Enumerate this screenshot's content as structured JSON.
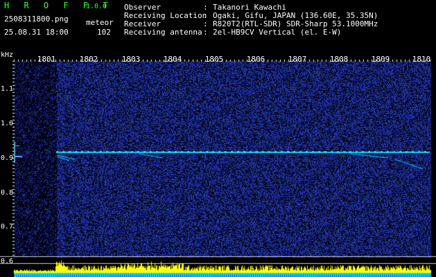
{
  "header": {
    "app_name": "H R O F F T",
    "version": "1.0.0",
    "filename": "2508311800.png",
    "category": "meteor",
    "datetime": "25.08.31 18:00",
    "count": "102"
  },
  "info": [
    {
      "label": "Observer",
      "value": "Takanori Kawachi"
    },
    {
      "label": "Receiving Location",
      "value": "Ogaki, Gifu, JAPAN (136.60E, 35.35N)"
    },
    {
      "label": "Receiver",
      "value": "R820T2(RTL-SDR) SDR-Sharp 53.1000MHz"
    },
    {
      "label": "Receiving antenna",
      "value": "2el-HB9CV Vertical (el. E-W)"
    }
  ],
  "plot": {
    "y_unit": "kHz",
    "y_ticks": [
      "1.1",
      "1.0",
      "0.9",
      "0.8",
      "0.7",
      "0.6"
    ],
    "x_ticks": [
      "1801",
      "1802",
      "1803",
      "1804",
      "1805",
      "1806",
      "1807",
      "1808",
      "1809",
      "1810"
    ],
    "colors": {
      "background": "#000000",
      "noise": "#1a2a8a",
      "carrier": "#00d8ff",
      "echo": "#ffff00",
      "band_top": "#00e0ff"
    }
  }
}
